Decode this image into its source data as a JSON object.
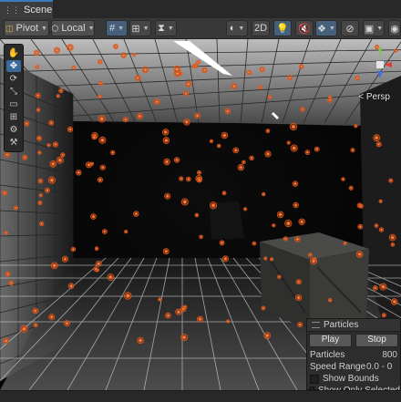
{
  "tab": {
    "icon": "scene-grid-icon",
    "title": "Scene"
  },
  "toolbar": {
    "pivot_label": "Pivot",
    "local_label": "Local",
    "mode_2d_label": "2D"
  },
  "tools": [
    {
      "name": "hand-tool-icon",
      "glyph": "✋"
    },
    {
      "name": "move-tool-icon",
      "glyph": "✥"
    },
    {
      "name": "rotate-tool-icon",
      "glyph": "⟳"
    },
    {
      "name": "scale-tool-icon",
      "glyph": "⤡"
    },
    {
      "name": "rect-tool-icon",
      "glyph": "▭"
    },
    {
      "name": "transform-tool-icon",
      "glyph": "⊞"
    },
    {
      "name": "custom-tool-icon",
      "glyph": "⚙"
    },
    {
      "name": "custom-tool-2-icon",
      "glyph": "⚒"
    }
  ],
  "scene": {
    "camera_mode_label": "Persp",
    "particle_color": "#e85a1c"
  },
  "particles_overlay": {
    "title": "Particles",
    "play_label": "Play",
    "stop_label": "Stop",
    "rows": [
      {
        "label": "Particles",
        "value": "800"
      },
      {
        "label": "Speed Range",
        "value": "0.0 - 0"
      }
    ],
    "checkboxes": [
      {
        "label": "Show Bounds"
      },
      {
        "label": "Show Only Selected"
      }
    ]
  }
}
